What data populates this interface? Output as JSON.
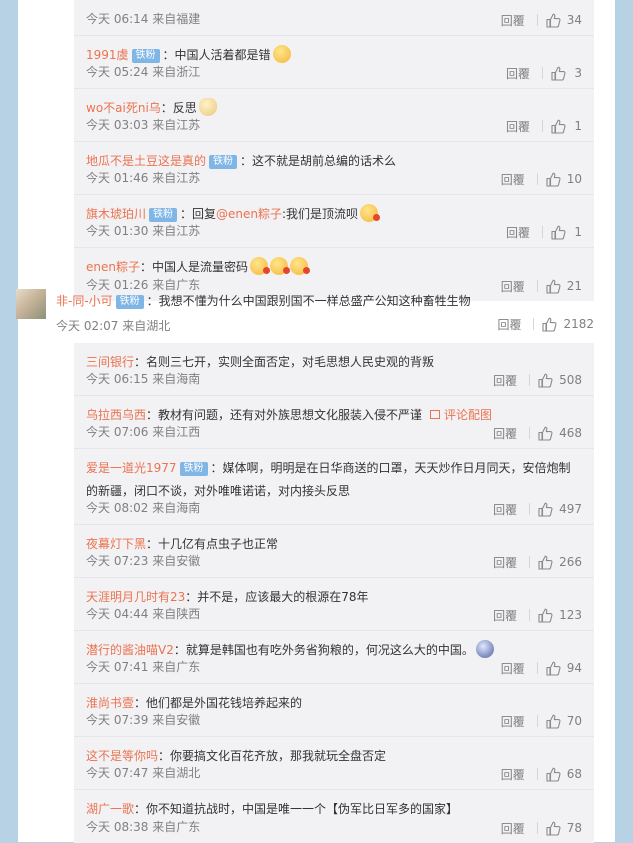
{
  "group1": [
    {
      "user": "",
      "badge": "",
      "pre": "",
      "link": "",
      "text": "",
      "emoji": [],
      "time": "今天 06:14 来自福建",
      "reply": "回覆",
      "likes": "34"
    },
    {
      "user": "1991虞",
      "badge": "铁粉",
      "pre": "",
      "link": "",
      "text": "：中国人活着都是错",
      "emoji": [
        "cry"
      ],
      "time": "今天 05:24 来自浙江",
      "reply": "回覆",
      "likes": "3"
    },
    {
      "user": "wo不ai死ni乌",
      "badge": "",
      "pre": "",
      "link": "",
      "text": "：反思",
      "emoji": [
        "cat"
      ],
      "time": "今天 03:03 来自江苏",
      "reply": "回覆",
      "likes": "1"
    },
    {
      "user": "地瓜不是土豆这是真的",
      "badge": "铁粉",
      "pre": "",
      "link": "",
      "text": "：这不就是胡前总编的话术么",
      "emoji": [],
      "time": "今天 01:46 来自江苏",
      "reply": "回覆",
      "likes": "10"
    },
    {
      "user": "旗木琥珀川",
      "badge": "铁粉",
      "pre": "：回复",
      "link": "@enen粽子",
      "text": ":我们是顶流呗",
      "emoji": [
        "heart"
      ],
      "time": "今天 01:30 来自江苏",
      "reply": "回覆",
      "likes": "1"
    },
    {
      "user": "enen粽子",
      "badge": "",
      "pre": "",
      "link": "",
      "text": "：中国人是流量密码",
      "emoji": [
        "heart",
        "heart",
        "heart"
      ],
      "time": "今天 01:26 来自广东",
      "reply": "回覆",
      "likes": "21"
    }
  ],
  "main_comment": {
    "user": "非-同-小可",
    "badge": "铁粉",
    "text": "：我想不懂为什么中国跟别国不一样总盛产公知这种畜牲生物",
    "time": "今天 02:07 来自湖北",
    "reply": "回覆",
    "likes": "2182"
  },
  "group2": [
    {
      "user": "三间银行",
      "badge": "",
      "text": "：名则三七开，实则全面否定，对毛思想人民史观的背叛",
      "emoji": [],
      "appeal": "",
      "time": "今天 06:15 来自海南",
      "reply": "回覆",
      "likes": "508"
    },
    {
      "user": "乌拉西乌西",
      "badge": "",
      "text": "：教材有问题，还有对外族思想文化服装入侵不严谨",
      "emoji": [],
      "appeal": "评论配图",
      "time": "今天 07:06 来自江西",
      "reply": "回覆",
      "likes": "468"
    },
    {
      "user": "爱是一道光1977",
      "badge": "铁粉",
      "text": "：媒体啊，明明是在日华商送的口罩，天天炒作日月同天，安倍炮制的新疆，闭口不谈，对外唯唯诺诺，对内接头反思",
      "emoji": [],
      "appeal": "",
      "time": "今天 08:02 来自海南",
      "reply": "回覆",
      "likes": "497"
    },
    {
      "user": "夜幕灯下黑",
      "badge": "",
      "text": "：十几亿有点虫子也正常",
      "emoji": [],
      "appeal": "",
      "time": "今天 07:23 来自安徽",
      "reply": "回覆",
      "likes": "266"
    },
    {
      "user": "天涯明月几时有23",
      "badge": "",
      "text": "：并不是，应该最大的根源在78年",
      "emoji": [],
      "appeal": "",
      "time": "今天 04:44 来自陕西",
      "reply": "回覆",
      "likes": "123"
    },
    {
      "user": "潜行的酱油喵V2",
      "badge": "",
      "text": "：就算是韩国也有吃外务省狗粮的，何况这么大的中国。",
      "emoji": [
        "blue"
      ],
      "appeal": "",
      "time": "今天 07:41 来自广东",
      "reply": "回覆",
      "likes": "94"
    },
    {
      "user": "淮尚书壹",
      "badge": "",
      "text": "：他们都是外国花钱培养起来的",
      "emoji": [],
      "appeal": "",
      "time": "今天 07:39 来自安徽",
      "reply": "回覆",
      "likes": "70"
    },
    {
      "user": "这不是等你吗",
      "badge": "",
      "text": "：你要搞文化百花齐放，那我就玩全盘否定",
      "emoji": [],
      "appeal": "",
      "time": "今天 07:47 来自湖北",
      "reply": "回覆",
      "likes": "68"
    },
    {
      "user": "湖广一歌",
      "badge": "",
      "text": "：你不知道抗战时，中国是唯一一个【伪军比日军多的国家】",
      "emoji": [],
      "appeal": "",
      "time": "今天 08:38 来自广东",
      "reply": "回覆",
      "likes": "78"
    }
  ]
}
